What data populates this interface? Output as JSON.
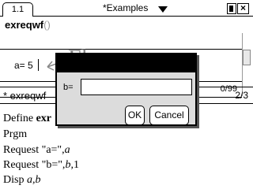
{
  "tabbar": {
    "active_tab": "1.1",
    "document_title": "*Examples"
  },
  "calculator": {
    "entry_name": "exreqwf",
    "entry_parens": "()",
    "prompt": "a= 5",
    "annotation": "Flag",
    "status_count": "0/99"
  },
  "editor": {
    "title": "* exreqwf",
    "page": "2/3",
    "lines": [
      {
        "pre": "Define ",
        "bold": "exr"
      },
      {
        "pre": "Prgm"
      },
      {
        "pre": "Request \"a=\",",
        "var": "a"
      },
      {
        "pre": "Request \"b=\",",
        "var": "b",
        "post": ",1"
      },
      {
        "pre": "Disp ",
        "var": "a,b"
      }
    ]
  },
  "dialog": {
    "label": "b=",
    "input_value": "",
    "ok_label": "OK",
    "cancel_label": "Cancel"
  },
  "colors": {
    "dialog_bg": "#dcdcdc",
    "annotation": "#888888"
  },
  "icons": [
    "battery-icon",
    "close-icon",
    "dropdown-arrow-icon",
    "flag-arrow-icon"
  ]
}
